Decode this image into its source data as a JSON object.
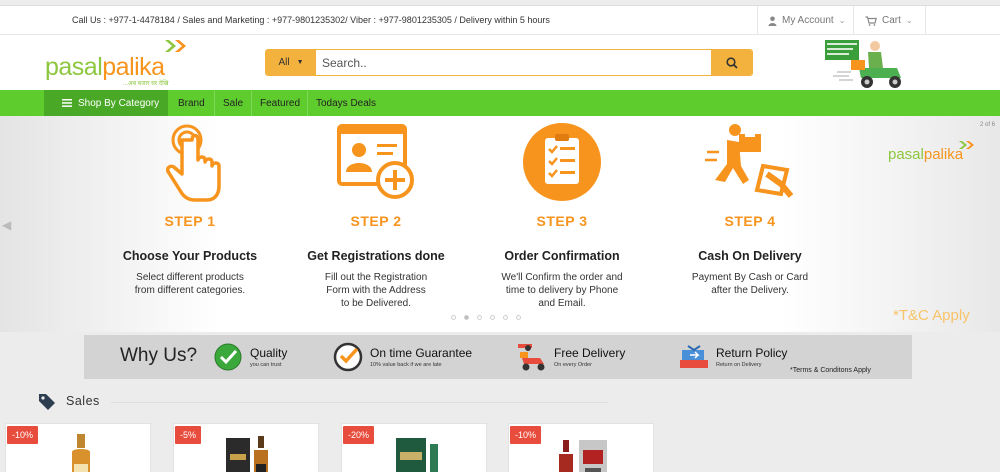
{
  "topbar": {
    "info": "Call Us : +977-1-4478184 / Sales and Marketing : +977-9801235302/ Viber : +977-9801235305 / Delivery within 5 hours",
    "account_label": "My Account",
    "cart_label": "Cart"
  },
  "header": {
    "logo_part1": "pasal",
    "logo_part2": "palika",
    "logo_tagline": "...अब बजार घर देखि",
    "search": {
      "category": "All",
      "placeholder": "Search.."
    }
  },
  "nav": {
    "shop_by_category": "Shop By Category",
    "items": [
      "Brand",
      "Sale",
      "Featured",
      "Todays Deals"
    ]
  },
  "banner": {
    "page_indicator": "2 of 6",
    "logo_part1": "pasal",
    "logo_part2": "palika",
    "tc": "*T&C Apply",
    "active_slide": 2,
    "slide_count": 6,
    "steps": [
      {
        "num": "STEP 1",
        "title": "Choose Your Products",
        "desc1": "Select different products",
        "desc2": "from different categories.",
        "desc3": ""
      },
      {
        "num": "STEP 2",
        "title": "Get Registrations done",
        "desc1": "Fill out the Registration",
        "desc2": "Form with the Address",
        "desc3": "to be Delivered."
      },
      {
        "num": "STEP 3",
        "title": "Order Confirmation",
        "desc1": "We'll Confirm the order and",
        "desc2": "time to delivery by Phone",
        "desc3": "and Email."
      },
      {
        "num": "STEP 4",
        "title": "Cash On Delivery",
        "desc1": "Payment By Cash or Card",
        "desc2": "after the Delivery.",
        "desc3": ""
      }
    ]
  },
  "why_us": {
    "title": "Why Us?",
    "features": [
      {
        "label": "Quality",
        "sub": "you can trust"
      },
      {
        "label": "On time Guarantee",
        "sub": "10% value back if we are late"
      },
      {
        "label": "Free Delivery",
        "sub": "On every Order"
      },
      {
        "label": "Return Policy",
        "sub": "Return on Delivery"
      }
    ],
    "terms": "*Terms & Conditons Apply"
  },
  "sales": {
    "title": "Sales",
    "products": [
      {
        "discount": "-10%"
      },
      {
        "discount": "-5%"
      },
      {
        "discount": "-20%"
      },
      {
        "discount": "-10%"
      }
    ]
  },
  "colors": {
    "green": "#5fcc2e",
    "orange": "#f7941d",
    "search_accent": "#f3b23d",
    "badge_red": "#e74c3c"
  }
}
